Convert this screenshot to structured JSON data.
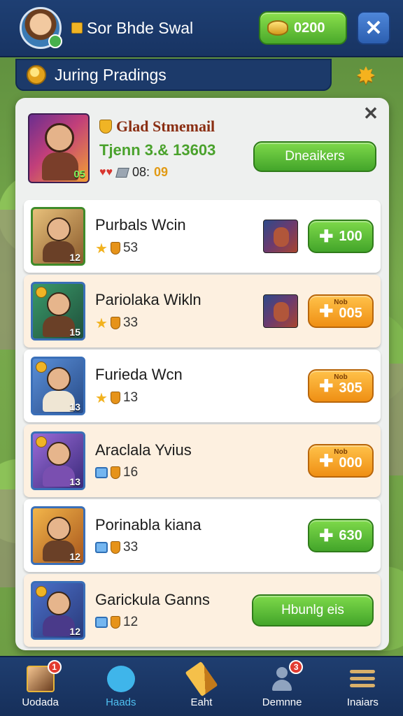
{
  "header": {
    "player_name": "Sor Bhde Swal",
    "coins": "0200",
    "close": "✕"
  },
  "subheader": {
    "title": "Juring Pradings"
  },
  "panel": {
    "close": "✕",
    "featured": {
      "title": "Glad Stmemail",
      "subtitle": "Tjenn 3.& 13603",
      "level": "05",
      "meta_value": "08:",
      "meta_value2": "09",
      "action_label": "Dneaikers"
    },
    "rows": [
      {
        "name": "Purbals Wcin",
        "stars": "53",
        "level": "12",
        "action_amount": "100",
        "action_style": "green",
        "action_mini": "",
        "stat_icon": "star-icon"
      },
      {
        "name": "Pariolaka Wikln",
        "stars": "33",
        "level": "15",
        "action_amount": "005",
        "action_style": "orange",
        "action_mini": "Nob",
        "stat_icon": "star-icon"
      },
      {
        "name": "Furieda Wcn",
        "stars": "13",
        "level": "13",
        "action_amount": "305",
        "action_style": "orange",
        "action_mini": "Nob",
        "stat_icon": "star-icon"
      },
      {
        "name": "Araclala Yvius",
        "stars": "16",
        "level": "13",
        "action_amount": "000",
        "action_style": "orange",
        "action_mini": "Nob",
        "stat_icon": "gem-blue-icon"
      },
      {
        "name": "Porinabla kiana",
        "stars": "33",
        "level": "12",
        "action_amount": "630",
        "action_style": "green",
        "action_mini": "",
        "stat_icon": "gem-blue-icon"
      },
      {
        "name": "Garickula Ganns",
        "stars": "12",
        "level": "12",
        "action_label": "Hbunlg eis",
        "stat_icon": "gem-blue-icon"
      }
    ]
  },
  "bottom_nav": [
    {
      "label": "Uodada",
      "badge": "1",
      "icon": "portrait-icon"
    },
    {
      "label": "Haads",
      "badge": "",
      "icon": "chat-icon",
      "active": true
    },
    {
      "label": "Eaht",
      "badge": "",
      "icon": "pencil-icon"
    },
    {
      "label": "Demnne",
      "badge": "3",
      "icon": "person-icon"
    },
    {
      "label": "Inaiars",
      "badge": "",
      "icon": "menu-icon"
    }
  ],
  "colors": {
    "topbar": "#1e3f73",
    "green_button": "#4aa92b",
    "orange_button": "#ef8f14",
    "panel": "#eef0ef",
    "active_nav": "#4fc0f0"
  }
}
